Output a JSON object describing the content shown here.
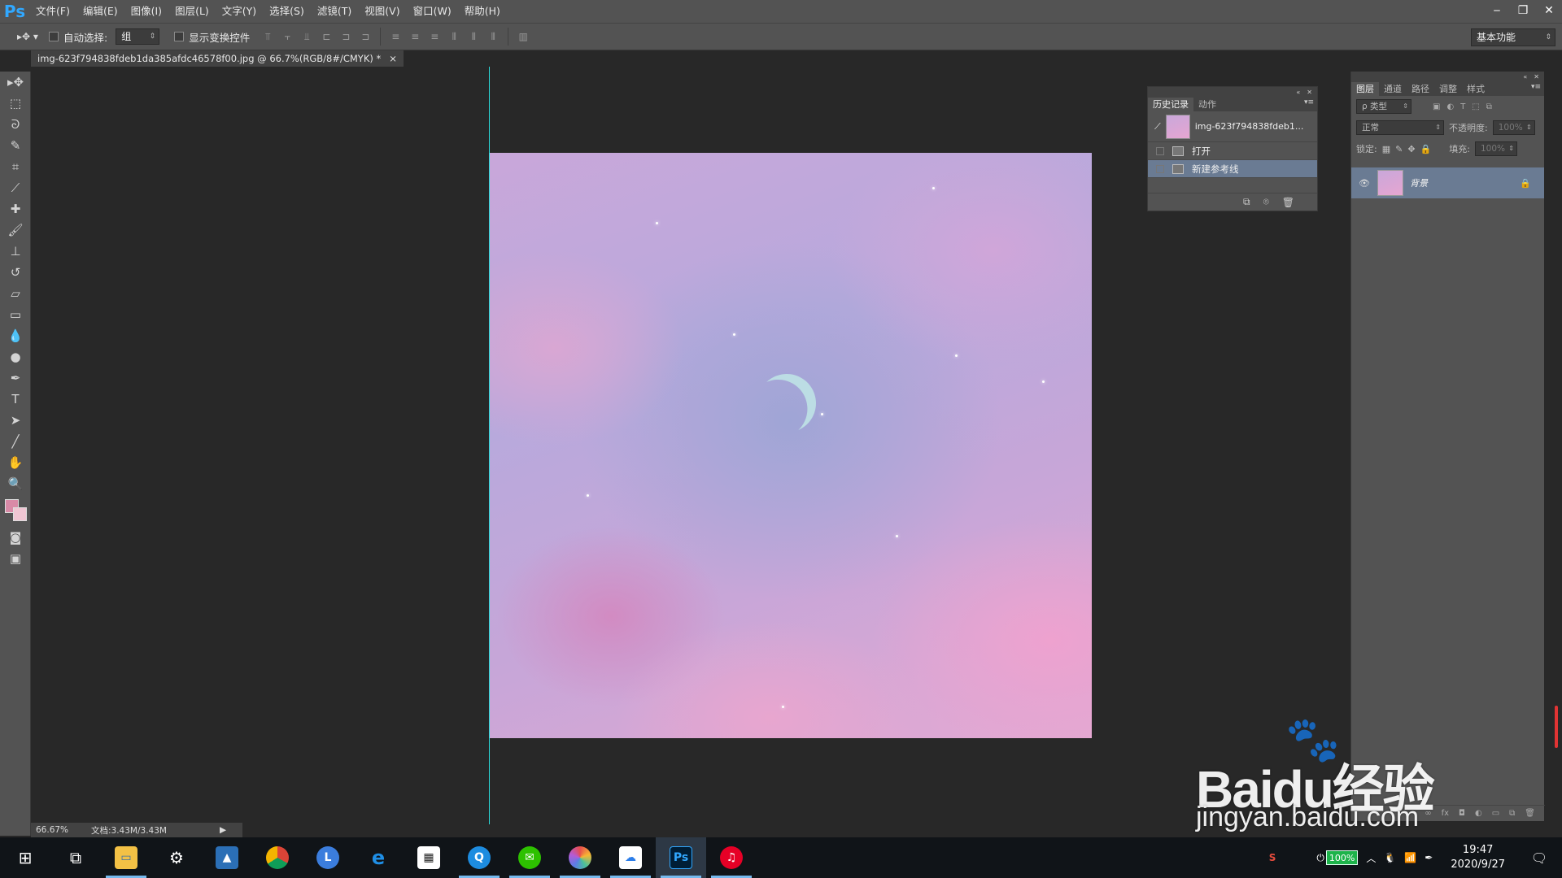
{
  "app": {
    "logo": "Ps",
    "menu": [
      "文件(F)",
      "编辑(E)",
      "图像(I)",
      "图层(L)",
      "文字(Y)",
      "选择(S)",
      "滤镜(T)",
      "视图(V)",
      "窗口(W)",
      "帮助(H)"
    ],
    "window_controls": [
      "minimize",
      "restore",
      "close"
    ]
  },
  "options": {
    "auto_select_label": "自动选择:",
    "auto_select_value": "组",
    "show_transform_label": "显示变换控件",
    "workspace": "基本功能"
  },
  "document": {
    "tab_title": "img-623f794838fdeb1da385afdc46578f00.jpg @ 66.7%(RGB/8#/CMYK) *",
    "tab_close": "×"
  },
  "status": {
    "zoom": "66.67%",
    "doc_size": "文档:3.43M/3.43M"
  },
  "history_panel": {
    "tabs": [
      "历史记录",
      "动作"
    ],
    "snapshot_name": "img-623f794838fdeb1...",
    "items": [
      "打开",
      "新建参考线"
    ],
    "selected_index": 1
  },
  "layers_panel": {
    "tabs": [
      "图层",
      "通道",
      "路径",
      "调整",
      "样式"
    ],
    "filter_kind": "ρ 类型",
    "blend_mode": "正常",
    "opacity_label": "不透明度:",
    "opacity_value": "100%",
    "lock_label": "锁定:",
    "fill_label": "填充:",
    "fill_value": "100%",
    "layers": [
      {
        "name": "背景",
        "locked": true,
        "visible": true
      }
    ]
  },
  "taskbar": {
    "apps": [
      "start",
      "task-view",
      "file-explorer",
      "settings",
      "photos",
      "chrome",
      "lightshot",
      "edge",
      "store",
      "qq-browser",
      "wechat",
      "color-app",
      "baidu-netdisk",
      "photoshop",
      "netease-music"
    ],
    "battery": "100%",
    "time": "19:47",
    "date": "2020/9/27"
  },
  "watermark": {
    "brand": "Baidu经验",
    "site": "jingyan.baidu.com"
  },
  "colors": {
    "accent": "#31a8ff",
    "guide": "#2bd6d6",
    "foreground": "#d98aa7",
    "background": "#f0c6d3",
    "selection": "#6a7b93"
  }
}
